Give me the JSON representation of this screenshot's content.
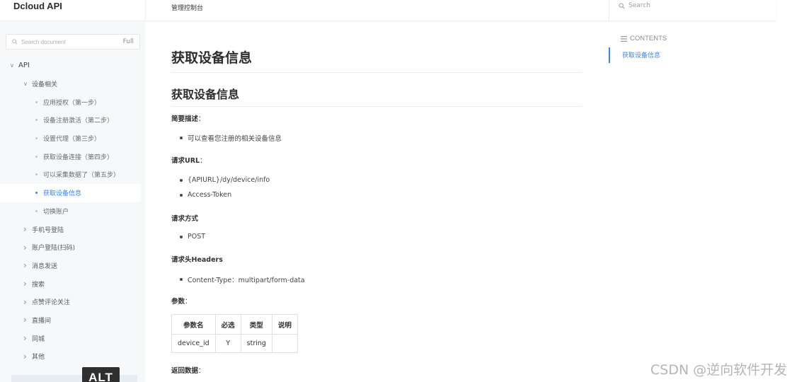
{
  "topbar": {
    "brand": "Dcloud API",
    "nav_label": "管理控制台",
    "search_label": "Search"
  },
  "sidebar": {
    "search_placeholder": "Search document",
    "full_label": "Full",
    "tree": [
      {
        "label": "API",
        "level": 0,
        "expanded": true
      },
      {
        "label": "设备相关",
        "level": 1,
        "expanded": true
      },
      {
        "label": "应用授权（第一步）",
        "level": 2
      },
      {
        "label": "设备注册激活（第二步）",
        "level": 2
      },
      {
        "label": "设置代理（第三步）",
        "level": 2
      },
      {
        "label": "获取设备连接（第四步）",
        "level": 2
      },
      {
        "label": "可以采集数据了（第五步）",
        "level": 2
      },
      {
        "label": "获取设备信息",
        "level": 2,
        "active": true
      },
      {
        "label": "切换账户",
        "level": 2
      },
      {
        "label": "手机号登陆",
        "level": 1,
        "expanded": false
      },
      {
        "label": "账户登陆(扫码)",
        "level": 1,
        "expanded": false
      },
      {
        "label": "消息发送",
        "level": 1,
        "expanded": false
      },
      {
        "label": "搜索",
        "level": 1,
        "expanded": false
      },
      {
        "label": "点赞评论关注",
        "level": 1,
        "expanded": false
      },
      {
        "label": "直播间",
        "level": 1,
        "expanded": false
      },
      {
        "label": "同城",
        "level": 1,
        "expanded": false
      },
      {
        "label": "其他",
        "level": 1,
        "expanded": false
      }
    ],
    "alt_badge": "ALT"
  },
  "main": {
    "h1": "获取设备信息",
    "h2": "获取设备信息",
    "desc_title": "简要描述",
    "desc_items": [
      "可以查看您注册的相关设备信息"
    ],
    "url_title": "请求URL",
    "url_items": [
      "{APIURL}/dy/device/info",
      "Access-Token"
    ],
    "method_title": "请求方式",
    "method_items": [
      "POST"
    ],
    "headers_title": "请求头Headers",
    "headers_items": [
      "Content-Type：multipart/form-data"
    ],
    "params_title": "参数",
    "params_table": {
      "headers": [
        "参数名",
        "必选",
        "类型",
        "说明"
      ],
      "rows": [
        [
          "device_id",
          "Y",
          "string",
          ""
        ]
      ]
    },
    "return_title": "返回数据"
  },
  "contents": {
    "heading": "CONTENTS",
    "items": [
      "获取设备信息"
    ]
  },
  "watermark": "CSDN @逆向软件开发",
  "colors": {
    "accent": "#3b82f6",
    "sidebar_bg": "#f7f8fa"
  }
}
